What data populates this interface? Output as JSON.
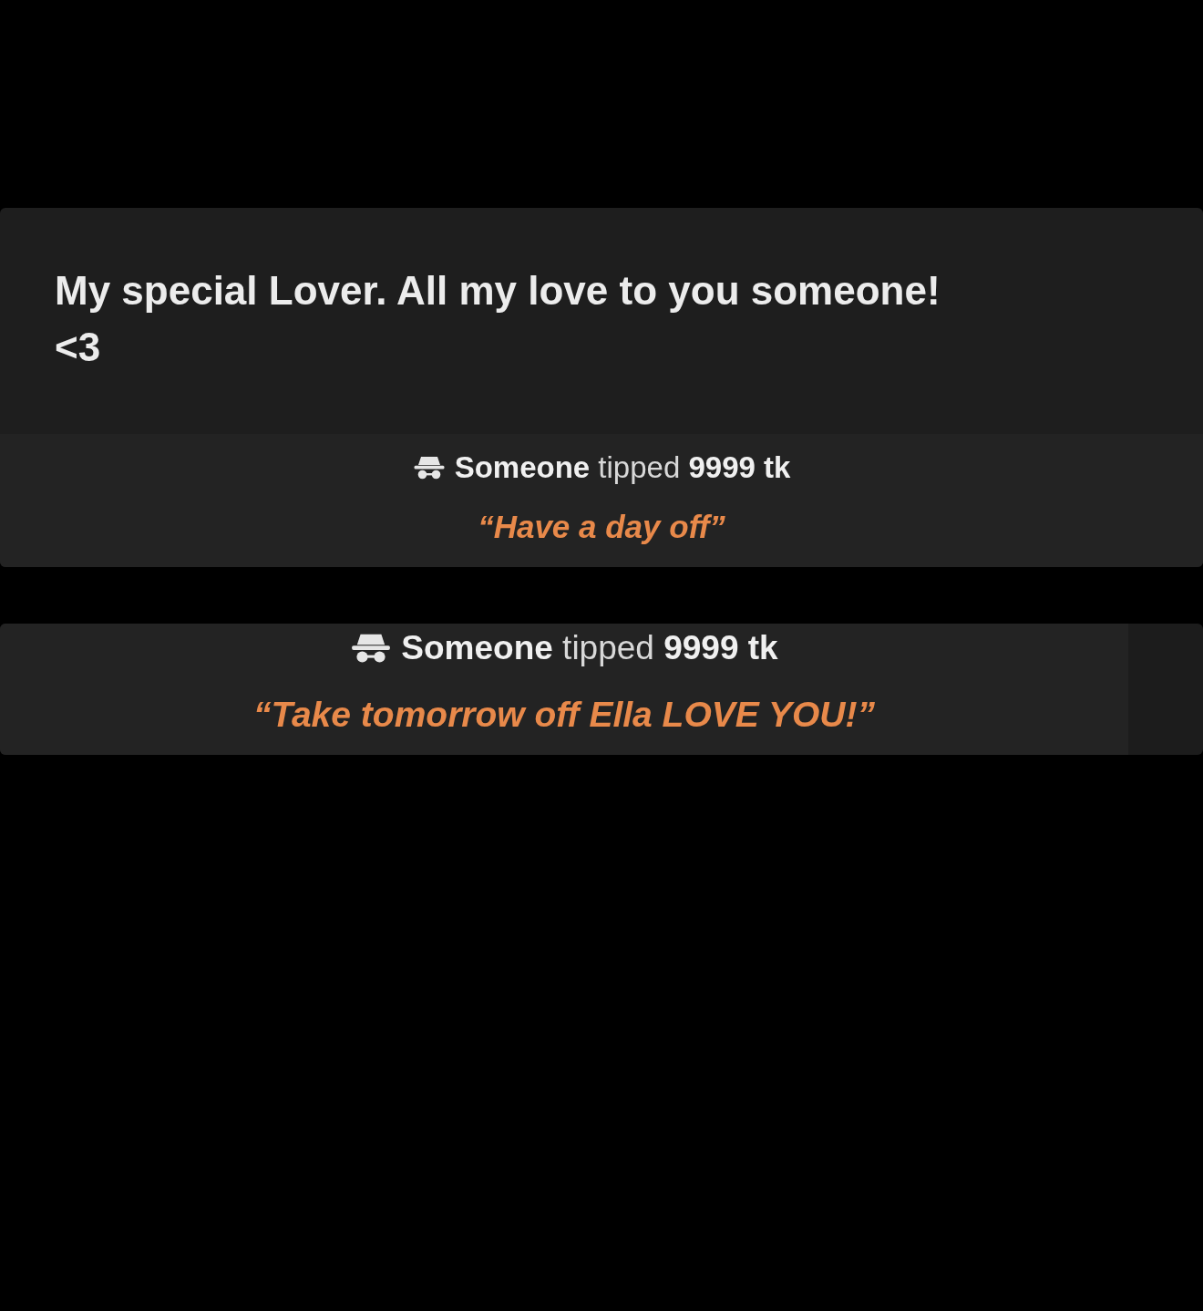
{
  "message": {
    "title": "My special Lover. All my love to you someone! <3"
  },
  "tips": [
    {
      "line": "**Someone** tipped **9999 tk**",
      "note": "“Have a day off”",
      "kind": "compact"
    },
    {
      "line": "**Someone** tipped **9999 tk**",
      "note": "“Take tomorrow off Ella LOVE YOU!”",
      "kind": "standalone"
    }
  ]
}
